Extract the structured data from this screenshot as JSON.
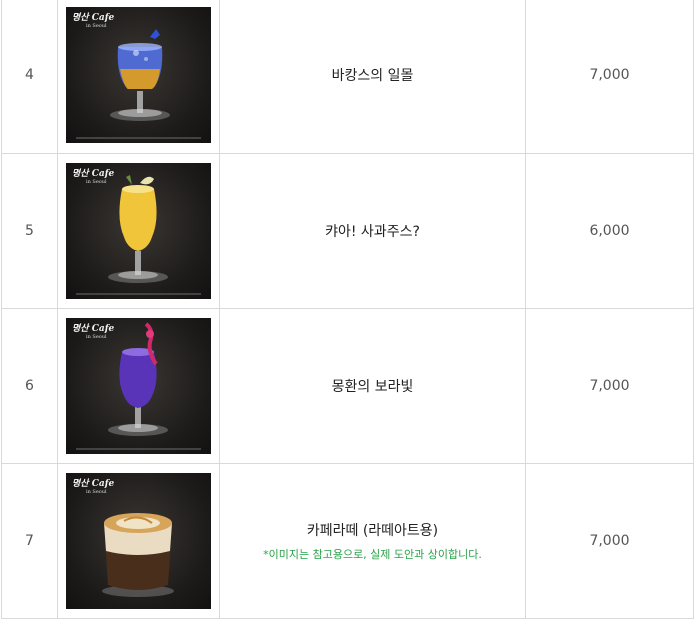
{
  "photo_logo": {
    "main": "명산 Cafe",
    "sub": "in Seoul"
  },
  "rows": [
    {
      "num": "4",
      "name": "바캉스의 일몰",
      "note": "",
      "price": "7,000",
      "drink": "blue-sunset-cocktail"
    },
    {
      "num": "5",
      "name": "캬아! 사과주스?",
      "note": "",
      "price": "6,000",
      "drink": "apple-juice-cocktail"
    },
    {
      "num": "6",
      "name": "몽환의 보라빛",
      "note": "",
      "price": "7,000",
      "drink": "purple-cocktail"
    },
    {
      "num": "7",
      "name": "카페라떼 (라떼아트용)",
      "note": "*이미지는 참고용으로, 실제 도안과 상이합니다.",
      "price": "7,000",
      "drink": "cafe-latte"
    }
  ],
  "colors": {
    "border": "#d9d9d9",
    "note": "#2aa24a",
    "photo_bg": "#1c1a19"
  }
}
